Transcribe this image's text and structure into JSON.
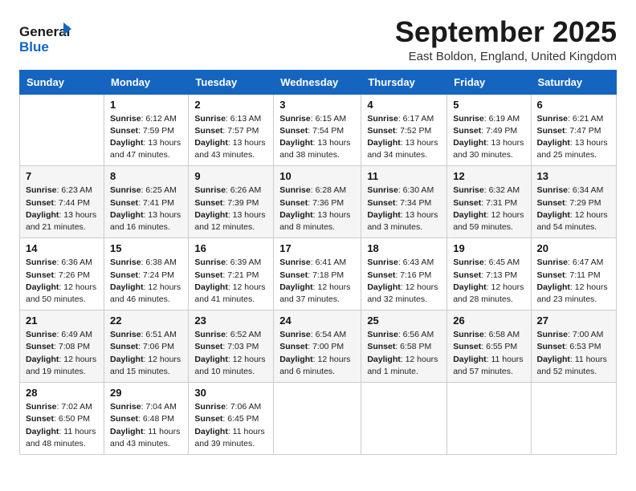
{
  "logo": {
    "text_general": "General",
    "text_blue": "Blue"
  },
  "header": {
    "month_title": "September 2025",
    "subtitle": "East Boldon, England, United Kingdom"
  },
  "columns": [
    "Sunday",
    "Monday",
    "Tuesday",
    "Wednesday",
    "Thursday",
    "Friday",
    "Saturday"
  ],
  "weeks": [
    [
      {
        "day": "",
        "sunrise": "",
        "sunset": "",
        "daylight": ""
      },
      {
        "day": "1",
        "sunrise": "Sunrise: 6:12 AM",
        "sunset": "Sunset: 7:59 PM",
        "daylight": "Daylight: 13 hours and 47 minutes."
      },
      {
        "day": "2",
        "sunrise": "Sunrise: 6:13 AM",
        "sunset": "Sunset: 7:57 PM",
        "daylight": "Daylight: 13 hours and 43 minutes."
      },
      {
        "day": "3",
        "sunrise": "Sunrise: 6:15 AM",
        "sunset": "Sunset: 7:54 PM",
        "daylight": "Daylight: 13 hours and 38 minutes."
      },
      {
        "day": "4",
        "sunrise": "Sunrise: 6:17 AM",
        "sunset": "Sunset: 7:52 PM",
        "daylight": "Daylight: 13 hours and 34 minutes."
      },
      {
        "day": "5",
        "sunrise": "Sunrise: 6:19 AM",
        "sunset": "Sunset: 7:49 PM",
        "daylight": "Daylight: 13 hours and 30 minutes."
      },
      {
        "day": "6",
        "sunrise": "Sunrise: 6:21 AM",
        "sunset": "Sunset: 7:47 PM",
        "daylight": "Daylight: 13 hours and 25 minutes."
      }
    ],
    [
      {
        "day": "7",
        "sunrise": "Sunrise: 6:23 AM",
        "sunset": "Sunset: 7:44 PM",
        "daylight": "Daylight: 13 hours and 21 minutes."
      },
      {
        "day": "8",
        "sunrise": "Sunrise: 6:25 AM",
        "sunset": "Sunset: 7:41 PM",
        "daylight": "Daylight: 13 hours and 16 minutes."
      },
      {
        "day": "9",
        "sunrise": "Sunrise: 6:26 AM",
        "sunset": "Sunset: 7:39 PM",
        "daylight": "Daylight: 13 hours and 12 minutes."
      },
      {
        "day": "10",
        "sunrise": "Sunrise: 6:28 AM",
        "sunset": "Sunset: 7:36 PM",
        "daylight": "Daylight: 13 hours and 8 minutes."
      },
      {
        "day": "11",
        "sunrise": "Sunrise: 6:30 AM",
        "sunset": "Sunset: 7:34 PM",
        "daylight": "Daylight: 13 hours and 3 minutes."
      },
      {
        "day": "12",
        "sunrise": "Sunrise: 6:32 AM",
        "sunset": "Sunset: 7:31 PM",
        "daylight": "Daylight: 12 hours and 59 minutes."
      },
      {
        "day": "13",
        "sunrise": "Sunrise: 6:34 AM",
        "sunset": "Sunset: 7:29 PM",
        "daylight": "Daylight: 12 hours and 54 minutes."
      }
    ],
    [
      {
        "day": "14",
        "sunrise": "Sunrise: 6:36 AM",
        "sunset": "Sunset: 7:26 PM",
        "daylight": "Daylight: 12 hours and 50 minutes."
      },
      {
        "day": "15",
        "sunrise": "Sunrise: 6:38 AM",
        "sunset": "Sunset: 7:24 PM",
        "daylight": "Daylight: 12 hours and 46 minutes."
      },
      {
        "day": "16",
        "sunrise": "Sunrise: 6:39 AM",
        "sunset": "Sunset: 7:21 PM",
        "daylight": "Daylight: 12 hours and 41 minutes."
      },
      {
        "day": "17",
        "sunrise": "Sunrise: 6:41 AM",
        "sunset": "Sunset: 7:18 PM",
        "daylight": "Daylight: 12 hours and 37 minutes."
      },
      {
        "day": "18",
        "sunrise": "Sunrise: 6:43 AM",
        "sunset": "Sunset: 7:16 PM",
        "daylight": "Daylight: 12 hours and 32 minutes."
      },
      {
        "day": "19",
        "sunrise": "Sunrise: 6:45 AM",
        "sunset": "Sunset: 7:13 PM",
        "daylight": "Daylight: 12 hours and 28 minutes."
      },
      {
        "day": "20",
        "sunrise": "Sunrise: 6:47 AM",
        "sunset": "Sunset: 7:11 PM",
        "daylight": "Daylight: 12 hours and 23 minutes."
      }
    ],
    [
      {
        "day": "21",
        "sunrise": "Sunrise: 6:49 AM",
        "sunset": "Sunset: 7:08 PM",
        "daylight": "Daylight: 12 hours and 19 minutes."
      },
      {
        "day": "22",
        "sunrise": "Sunrise: 6:51 AM",
        "sunset": "Sunset: 7:06 PM",
        "daylight": "Daylight: 12 hours and 15 minutes."
      },
      {
        "day": "23",
        "sunrise": "Sunrise: 6:52 AM",
        "sunset": "Sunset: 7:03 PM",
        "daylight": "Daylight: 12 hours and 10 minutes."
      },
      {
        "day": "24",
        "sunrise": "Sunrise: 6:54 AM",
        "sunset": "Sunset: 7:00 PM",
        "daylight": "Daylight: 12 hours and 6 minutes."
      },
      {
        "day": "25",
        "sunrise": "Sunrise: 6:56 AM",
        "sunset": "Sunset: 6:58 PM",
        "daylight": "Daylight: 12 hours and 1 minute."
      },
      {
        "day": "26",
        "sunrise": "Sunrise: 6:58 AM",
        "sunset": "Sunset: 6:55 PM",
        "daylight": "Daylight: 11 hours and 57 minutes."
      },
      {
        "day": "27",
        "sunrise": "Sunrise: 7:00 AM",
        "sunset": "Sunset: 6:53 PM",
        "daylight": "Daylight: 11 hours and 52 minutes."
      }
    ],
    [
      {
        "day": "28",
        "sunrise": "Sunrise: 7:02 AM",
        "sunset": "Sunset: 6:50 PM",
        "daylight": "Daylight: 11 hours and 48 minutes."
      },
      {
        "day": "29",
        "sunrise": "Sunrise: 7:04 AM",
        "sunset": "Sunset: 6:48 PM",
        "daylight": "Daylight: 11 hours and 43 minutes."
      },
      {
        "day": "30",
        "sunrise": "Sunrise: 7:06 AM",
        "sunset": "Sunset: 6:45 PM",
        "daylight": "Daylight: 11 hours and 39 minutes."
      },
      {
        "day": "",
        "sunrise": "",
        "sunset": "",
        "daylight": ""
      },
      {
        "day": "",
        "sunrise": "",
        "sunset": "",
        "daylight": ""
      },
      {
        "day": "",
        "sunrise": "",
        "sunset": "",
        "daylight": ""
      },
      {
        "day": "",
        "sunrise": "",
        "sunset": "",
        "daylight": ""
      }
    ]
  ]
}
